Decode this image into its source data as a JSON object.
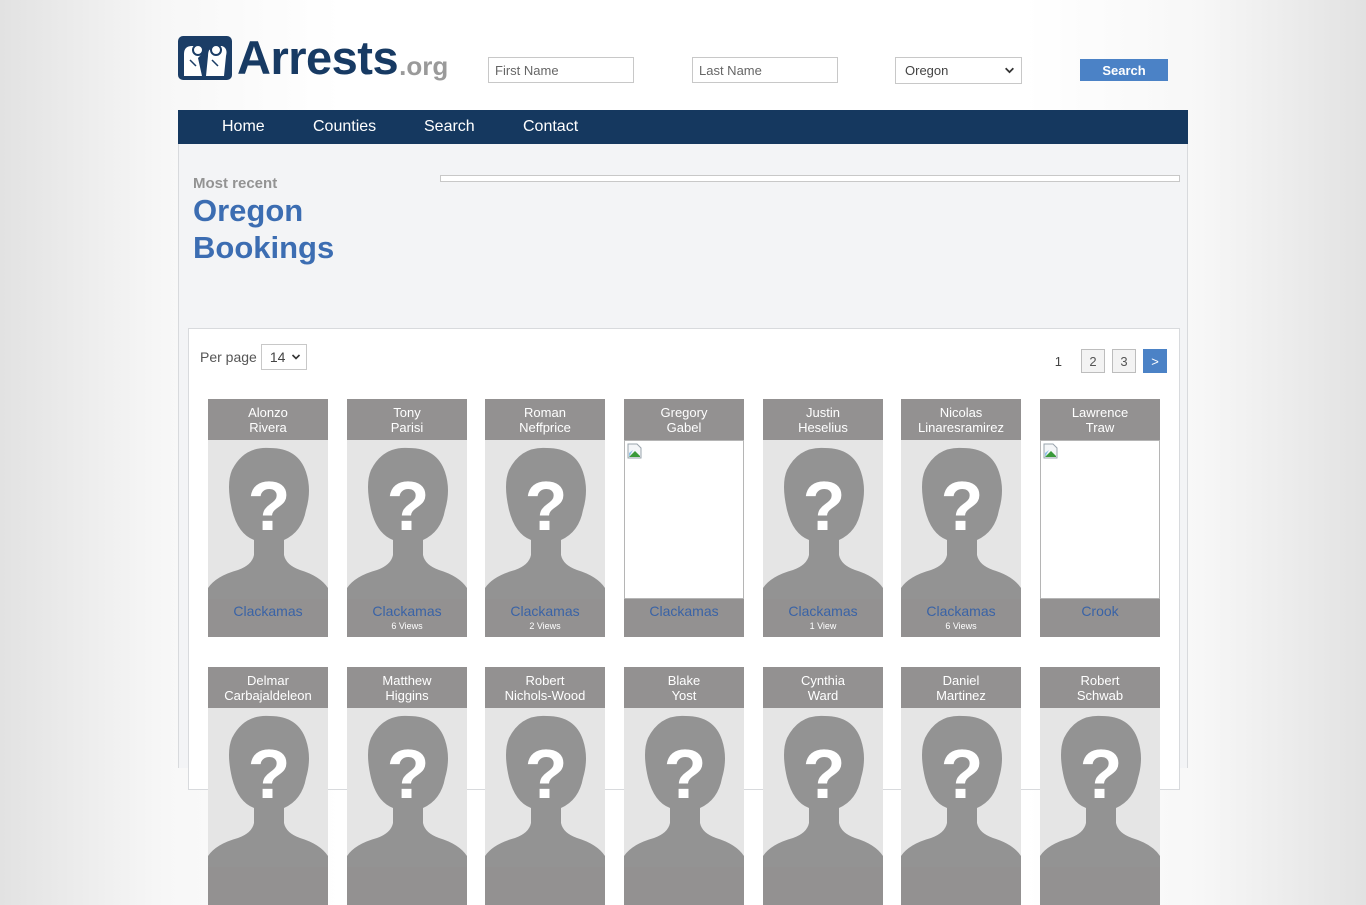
{
  "site": {
    "logo_main": "Arrests",
    "logo_suffix": ".org"
  },
  "search": {
    "first_name_placeholder": "First Name",
    "last_name_placeholder": "Last Name",
    "state_selected": "Oregon",
    "button_label": "Search"
  },
  "nav": {
    "items": [
      {
        "label": "Home"
      },
      {
        "label": "Counties"
      },
      {
        "label": "Search"
      },
      {
        "label": "Contact"
      }
    ]
  },
  "page": {
    "eyebrow": "Most recent",
    "title_line1": "Oregon",
    "title_line2": "Bookings"
  },
  "listing": {
    "per_page_label": "Per page",
    "per_page_value": "14",
    "pagination": {
      "current": "1",
      "pages": [
        "2",
        "3"
      ],
      "next_label": ">"
    },
    "cards": [
      {
        "first": "Alonzo",
        "last": "Rivera",
        "county": "Clackamas",
        "views": "",
        "photo": "placeholder"
      },
      {
        "first": "Tony",
        "last": "Parisi",
        "county": "Clackamas",
        "views": "6 Views",
        "photo": "placeholder"
      },
      {
        "first": "Roman",
        "last": "Neffprice",
        "county": "Clackamas",
        "views": "2 Views",
        "photo": "placeholder"
      },
      {
        "first": "Gregory",
        "last": "Gabel",
        "county": "Clackamas",
        "views": "",
        "photo": "broken"
      },
      {
        "first": "Justin",
        "last": "Heselius",
        "county": "Clackamas",
        "views": "1 View",
        "photo": "placeholder"
      },
      {
        "first": "Nicolas",
        "last": "Linaresramirez",
        "county": "Clackamas",
        "views": "6 Views",
        "photo": "placeholder"
      },
      {
        "first": "Lawrence",
        "last": "Traw",
        "county": "Crook",
        "views": "",
        "photo": "broken"
      },
      {
        "first": "Delmar",
        "last": "Carbajaldeleon",
        "county": "",
        "views": "",
        "photo": "placeholder"
      },
      {
        "first": "Matthew",
        "last": "Higgins",
        "county": "",
        "views": "",
        "photo": "placeholder"
      },
      {
        "first": "Robert",
        "last": "Nichols-Wood",
        "county": "",
        "views": "",
        "photo": "placeholder"
      },
      {
        "first": "Blake",
        "last": "Yost",
        "county": "",
        "views": "",
        "photo": "placeholder"
      },
      {
        "first": "Cynthia",
        "last": "Ward",
        "county": "",
        "views": "",
        "photo": "placeholder"
      },
      {
        "first": "Daniel",
        "last": "Martinez",
        "county": "",
        "views": "",
        "photo": "placeholder"
      },
      {
        "first": "Robert",
        "last": "Schwab",
        "county": "",
        "views": "",
        "photo": "placeholder"
      }
    ]
  },
  "colors": {
    "brand_navy": "#15385f",
    "accent_blue": "#4b82c6",
    "title_blue": "#3c6db2",
    "card_gray": "#939191"
  }
}
